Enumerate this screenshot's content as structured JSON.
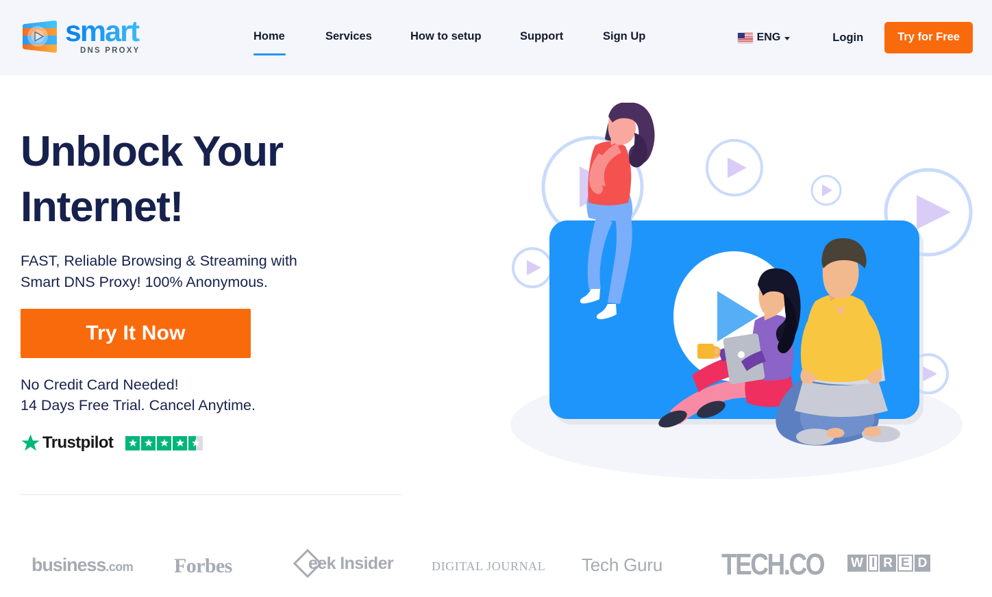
{
  "brand": {
    "name": "smart",
    "tagline": "DNS PROXY",
    "logo_icon": "play-media-logo-icon"
  },
  "header": {
    "background": "#f5f6fb",
    "nav": [
      {
        "label": "Home",
        "active": true
      },
      {
        "label": "Services",
        "active": false
      },
      {
        "label": "How to setup",
        "active": false
      },
      {
        "label": "Support",
        "active": false
      },
      {
        "label": "Sign Up",
        "active": false
      }
    ],
    "language": {
      "label": "ENG",
      "flag": "us-flag-icon",
      "caret": "chevron-down-icon"
    },
    "login_label": "Login",
    "cta_label": "Try for Free",
    "cta_color": "#f96a0d",
    "active_underline_color": "#2196f3"
  },
  "hero": {
    "title_line1": "Unblock Your",
    "title_line2": "Internet!",
    "title_color": "#17214d",
    "subtitle_line1": "FAST, Reliable Browsing & Streaming with",
    "subtitle_line2": "Smart DNS Proxy! 100% Anonymous.",
    "cta_label": "Try It Now",
    "cta_color": "#f96a0d",
    "note_line1": "No Credit Card Needed!",
    "note_line2": "14 Days Free Trial. Cancel Anytime.",
    "trustpilot": {
      "name": "Trustpilot",
      "star_color": "#00b67a",
      "empty_color": "#dcdce6",
      "rating": 4.5,
      "stars_total": 5,
      "full_stars": 4,
      "half_stars": 1
    },
    "illustration": {
      "name": "people-watching-video-illustration",
      "screen_color": "#1e95fb",
      "play_circle_color": "#ffffff",
      "play_triangle_color": "#56aef6",
      "decor_circle_stroke": "#c7d8fb",
      "decor_triangle_color": "#d9cdf7"
    }
  },
  "press": {
    "logos": [
      {
        "name": "business.com",
        "main": "business",
        "suffix": ".com"
      },
      {
        "name": "Forbes"
      },
      {
        "name": "Geek Insider",
        "text": "eek Insider"
      },
      {
        "name": "DIGITAL JOURNAL"
      },
      {
        "name": "Tech Guru"
      },
      {
        "name": "TECH.CO"
      },
      {
        "name": "WIRED",
        "letters": [
          "W",
          "I",
          "R",
          "E",
          "D"
        ]
      }
    ],
    "color": "#a6abb3"
  }
}
